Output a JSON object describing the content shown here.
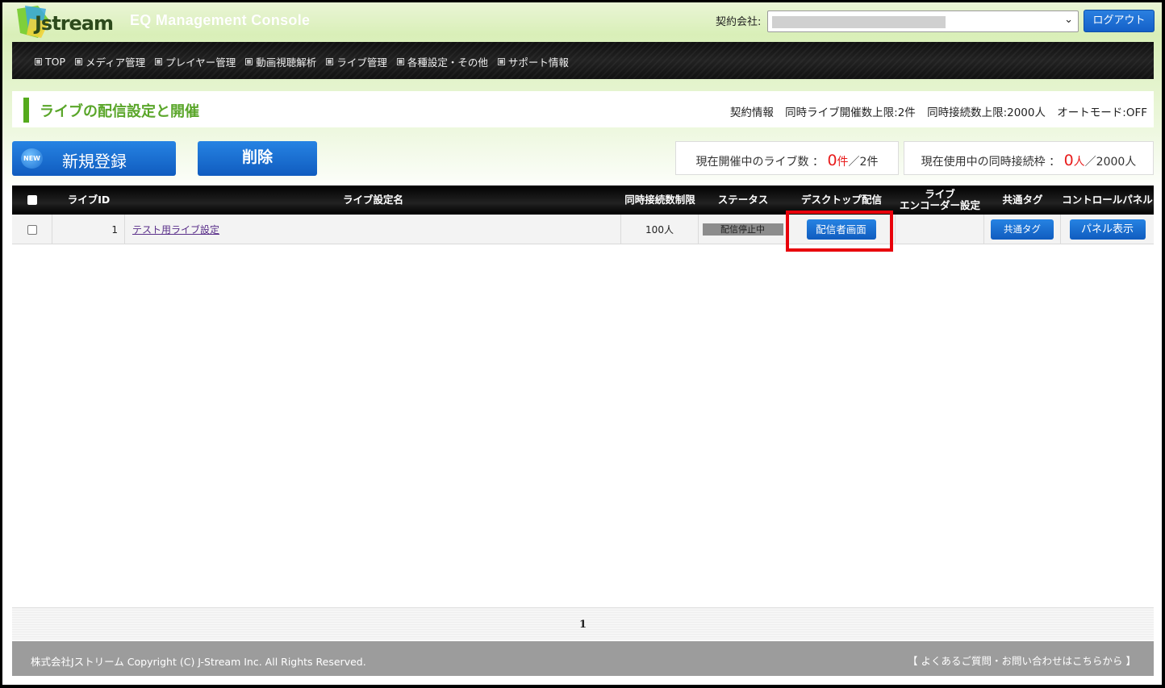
{
  "header": {
    "logo_text": "Jstream",
    "console_title": "EQ Management Console",
    "contract_label": "契約会社:",
    "logout_label": "ログアウト"
  },
  "nav": {
    "items": [
      "TOP",
      "メディア管理",
      "プレイヤー管理",
      "動画視聴解析",
      "ライブ管理",
      "各種設定・その他",
      "サポート情報"
    ]
  },
  "page": {
    "title": "ライブの配信設定と開催",
    "contract_info": {
      "label": "契約情報",
      "concurrent_live_limit": "同時ライブ開催数上限:2件",
      "concurrent_connection_limit": "同時接続数上限:2000人",
      "auto_mode": "オートモード:OFF"
    }
  },
  "actions": {
    "new_label": "新規登録",
    "new_badge": "NEW",
    "delete_label": "削除"
  },
  "stats": {
    "live_label": "現在開催中のライブ数 ：",
    "live_current": "0",
    "live_unit": "件",
    "live_max": "／2件",
    "conn_label": "現在使用中の同時接続枠 ：",
    "conn_current": "0",
    "conn_unit": "人",
    "conn_max": "／2000人"
  },
  "table": {
    "headers": {
      "live_id": "ライブID",
      "name": "ライブ設定名",
      "limit": "同時接続数制限",
      "status": "ステータス",
      "desktop": "デスクトップ配信",
      "encoder_l1": "ライブ",
      "encoder_l2": "エンコーダー設定",
      "tag": "共通タグ",
      "panel": "コントロールパネル"
    },
    "rows": [
      {
        "id": "1",
        "name": "テスト用ライブ設定",
        "limit": "100人",
        "status": "配信停止中",
        "desktop_btn": "配信者画面",
        "tag_btn": "共通タグ",
        "panel_btn": "パネル表示"
      }
    ]
  },
  "pagination": {
    "current": "1"
  },
  "footer": {
    "copyright": "株式会社Jストリーム  Copyright (C) J-Stream Inc. All Rights Reserved.",
    "faq_link": "【 よくあるご質問・お問い合わせはこちらから 】"
  },
  "colors": {
    "accent_blue": "#1a6fd4",
    "title_green": "#5aa62a",
    "highlight_red": "#e8000b",
    "stat_red": "#e81d1d"
  }
}
